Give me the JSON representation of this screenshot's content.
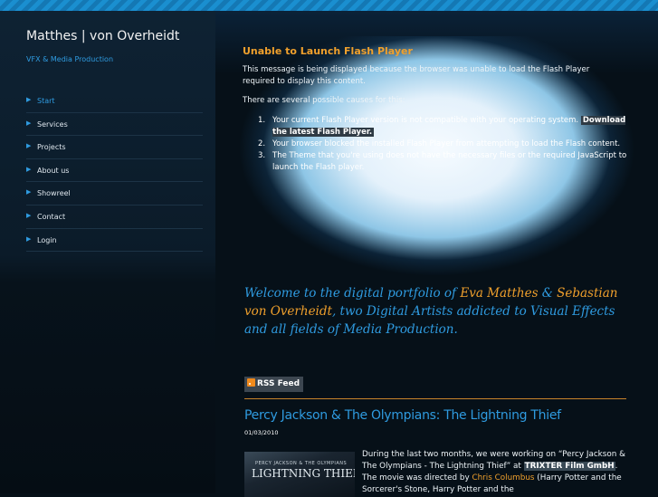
{
  "site": {
    "title": "Matthes | von Overheidt",
    "subtitle": "VFX & Media Production"
  },
  "nav": {
    "items": [
      {
        "label": "Start",
        "active": true
      },
      {
        "label": "Services"
      },
      {
        "label": "Projects"
      },
      {
        "label": "About us"
      },
      {
        "label": "Showreel"
      },
      {
        "label": "Contact"
      },
      {
        "label": "Login"
      }
    ]
  },
  "flash": {
    "title": "Unable to Launch Flash Player",
    "message": "This message is being displayed because the browser was unable to load the Flash Player required to display this content.",
    "causes_intro": "There are several possible causes for this:",
    "causes": [
      {
        "num": "1.",
        "text": "Your current Flash Player version is not compatible with your operating system.",
        "link": "Download the latest Flash Player."
      },
      {
        "num": "2.",
        "text": "Your browser blocked the installed Flash Player from attempting to load the Flash content."
      },
      {
        "num": "3.",
        "text": "The Theme that you're using does not have the necessary files or the required JavaScript to launch the Flash player."
      }
    ]
  },
  "welcome": {
    "prefix": "Welcome to the digital portfolio of ",
    "name1": "Eva Matthes",
    "amp": " & ",
    "name2": "Sebastian von Overheidt",
    "suffix": ", two Digital Artists addicted to Visual Effects and all fields of Media Production."
  },
  "rss": {
    "label": "RSS Feed",
    "icon": "rss-icon"
  },
  "post": {
    "title": "Percy Jackson & The Olympians: The Lightning Thief",
    "date": "01/03/2010",
    "thumb_small": "PERCY JACKSON & THE OLYMPIANS",
    "thumb_big": "LIGHTNING THIEF",
    "text_1": "During the last two months, we were working on “Percy Jackson & The Olympians - The Lightning Thief” at ",
    "company": "TRIXTER Film GmbH",
    "text_2": ". The movie was directed by ",
    "director": "Chris Columbus",
    "text_3": " (Harry Potter and the Sorcerer's Stone, Harry Potter and the"
  },
  "colors": {
    "accent": "#2f9be0",
    "highlight": "#f0a02c",
    "background": "#061018"
  }
}
